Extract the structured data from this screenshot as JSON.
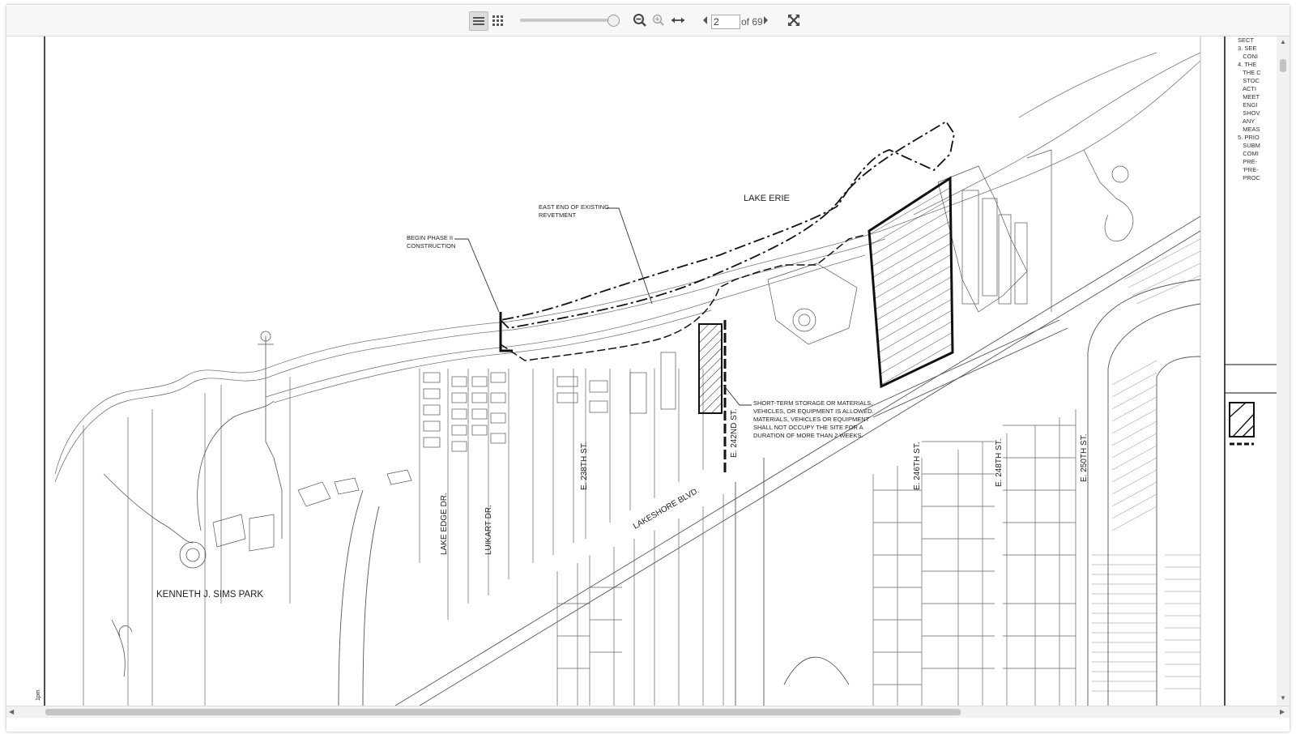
{
  "toolbar": {
    "page_current": "2",
    "page_total_label": "of 69",
    "zoom_level": 0.9
  },
  "map": {
    "labels": {
      "lake_erie": "LAKE ERIE",
      "east_end": "EAST END OF EXISTING",
      "revetment": "REVETMENT",
      "begin_phase": "BEGIN PHASE II",
      "construction": "CONSTRUCTION",
      "park": "KENNETH J. SIMS PARK",
      "lake_edge": "LAKE EDGE DR.",
      "luikart": "LUIKART DR.",
      "e238": "E. 238TH ST.",
      "e242": "E. 242ND ST.",
      "e246": "E. 246TH ST.",
      "e248": "E. 248TH ST.",
      "e250": "E. 250TH ST.",
      "lakeshore": "LAKESHORE BLVD."
    },
    "storage_note": [
      "SHORT-TERM STORAGE OR MATERIALS,",
      "VEHICLES, OR EQUIPMENT IS ALLOWED.",
      "MATERIALS, VEHICLES OR EQUIPMENT",
      "SHALL NOT OCCUPY THE SITE FOR A",
      "DURATION OF MORE THAN 2 WEEKS."
    ],
    "side_notes": "SECT\n3. SEE \n   CONI\n4. THE \n   THE C\n   STOC\n   ACTI\n   MEET\n   ENGI\n   SHOV\n   ANY \n   MEAS\n5. PRIO\n   SUBM\n   COMI\n   PRE-\n   'PRE-\n   PROC",
    "corner_mark": "1pm"
  }
}
